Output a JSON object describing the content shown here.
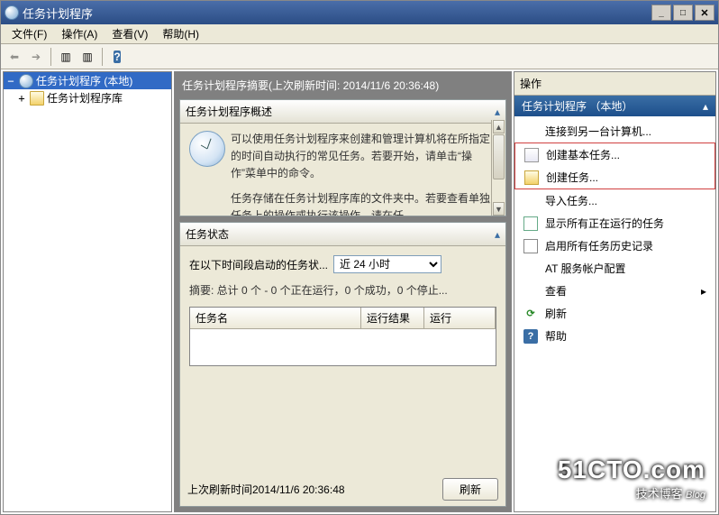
{
  "window": {
    "title": "任务计划程序"
  },
  "menu": {
    "file": "文件(F)",
    "action": "操作(A)",
    "view": "查看(V)",
    "help": "帮助(H)"
  },
  "tree": {
    "root": "任务计划程序 (本地)",
    "lib": "任务计划程序库"
  },
  "center": {
    "header": "任务计划程序摘要(上次刷新时间: 2014/11/6 20:36:48)",
    "overview_title": "任务计划程序概述",
    "overview_text1": "可以使用任务计划程序来创建和管理计算机将在所指定的时间自动执行的常见任务。若要开始，请单击“操作”菜单中的命令。",
    "overview_text2": "任务存储在任务计划程序库的文件夹中。若要查看单独任务上的操作或执行该操作，请在任",
    "status_title": "任务状态",
    "status_label": "在以下时间段启动的任务状...",
    "status_select": "近 24 小时",
    "summary": "摘要: 总计 0 个 - 0 个正在运行，0 个成功，0 个停止...",
    "col_name": "任务名",
    "col_result": "运行结果",
    "col_runtime": "运行",
    "last_refresh": "上次刷新时间2014/11/6 20:36:48",
    "refresh_btn": "刷新"
  },
  "actions": {
    "pane_title": "操作",
    "section_title": "任务计划程序 （本地）",
    "items": {
      "connect": "连接到另一台计算机...",
      "create_basic": "创建基本任务...",
      "create_task": "创建任务...",
      "import": "导入任务...",
      "show_running": "显示所有正在运行的任务",
      "enable_history": "启用所有任务历史记录",
      "at_service": "AT 服务帐户配置",
      "view": "查看",
      "refresh": "刷新",
      "help": "帮助"
    }
  },
  "watermark": {
    "site": "51CTO.com",
    "sub": "技术博客",
    "blog": "Blog"
  }
}
